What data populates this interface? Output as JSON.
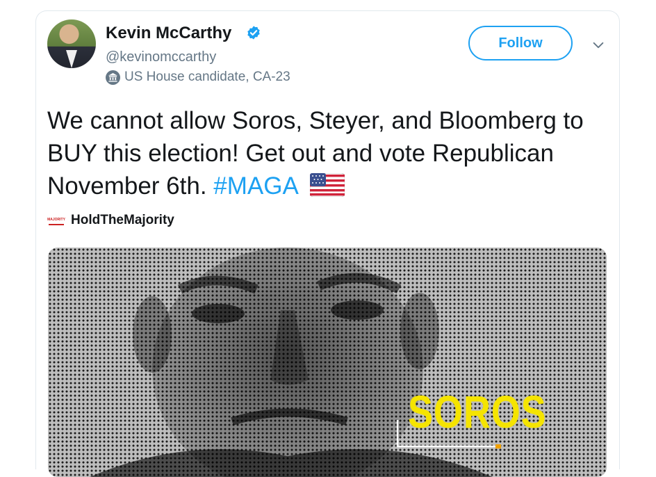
{
  "author": {
    "name": "Kevin McCarthy",
    "handle": "@kevinomccarthy",
    "label": "US House candidate, CA-23",
    "verified": true
  },
  "follow_label": "Follow",
  "tweet": {
    "text": "We cannot allow Soros, Steyer, and Bloomberg to BUY this election! Get out and vote Republican November 6th.",
    "hashtag": "#MAGA",
    "emoji": "us-flag"
  },
  "source": {
    "name": "HoldTheMajority",
    "logo_text": "MAJORITY"
  },
  "media": {
    "overlay_text": "SOROS"
  },
  "colors": {
    "accent": "#1da1f2",
    "secondary_text": "#657786",
    "primary_text": "#14171a",
    "overlay_yellow": "#f5e400"
  }
}
